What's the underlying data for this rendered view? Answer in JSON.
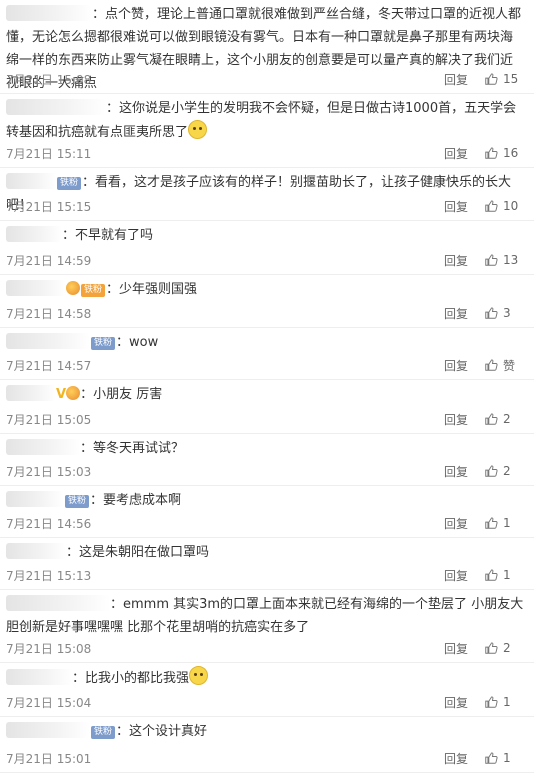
{
  "reply_label": "回复",
  "comments": [
    {
      "username_width": 86,
      "badge": "",
      "text": "：点个赞，理论上普通口罩就很难做到严丝合缝，冬天带过口罩的近视人都懂，无论怎么摁都很难说可以做到眼镜没有雾气。日本有一种口罩就是鼻子那里有两块海绵一样的东西来防止雾气凝在眼睛上，这个小朋友的创意要是可以量产真的解决了我们近视眼的一大痛点",
      "time": "7月21日 15:08",
      "likes": "15"
    },
    {
      "username_width": 100,
      "badge": "",
      "text": "：这你说是小学生的发明我不会怀疑，但是日做古诗1000首，五天学会转基因和抗癌就有点匪夷所思了",
      "emoji": true,
      "time": "7月21日 15:11",
      "likes": "16"
    },
    {
      "username_width": 50,
      "badge": "铁粉",
      "text": "：看看，这才是孩子应该有的样子！别揠苗助长了，让孩子健康快乐的长大吧！",
      "time": "7月21日 15:15",
      "likes": "10"
    },
    {
      "username_width": 56,
      "badge": "",
      "text": "：不早就有了吗",
      "time": "7月21日 14:59",
      "likes": "13"
    },
    {
      "username_width": 60,
      "badge": "铁粉",
      "badge_gold": true,
      "medal": true,
      "text": "：少年强则国强",
      "time": "7月21日 14:58",
      "likes": "3"
    },
    {
      "username_width": 84,
      "badge": "铁粉",
      "text": "：wow",
      "time": "7月21日 14:57",
      "likes": "赞"
    },
    {
      "username_width": 50,
      "badge": "",
      "vmark": "V",
      "medal": true,
      "text": "：小朋友 厉害",
      "time": "7月21日 15:05",
      "likes": "2"
    },
    {
      "username_width": 74,
      "badge": "",
      "text": "：等冬天再试试？",
      "time": "7月21日 15:03",
      "likes": "2"
    },
    {
      "username_width": 58,
      "badge": "铁粉",
      "text": "：要考虑成本啊",
      "time": "7月21日 14:56",
      "likes": "1"
    },
    {
      "username_width": 60,
      "badge": "",
      "text": "：这是朱朝阳在做口罩吗",
      "time": "7月21日 15:13",
      "likes": "1"
    },
    {
      "username_width": 104,
      "badge": "",
      "text": "：emmm 其实3m的口罩上面本来就已经有海绵的一个垫层了  小朋友大胆创新是好事嘿嘿嘿 比那个花里胡哨的抗癌实在多了",
      "time": "7月21日 15:08",
      "likes": "2"
    },
    {
      "username_width": 66,
      "badge": "",
      "text": "：比我小的都比我强",
      "emoji": true,
      "time": "7月21日 15:04",
      "likes": "1"
    },
    {
      "username_width": 84,
      "badge": "铁粉",
      "text": "：这个设计真好",
      "time": "7月21日 15:01",
      "likes": "1"
    }
  ]
}
